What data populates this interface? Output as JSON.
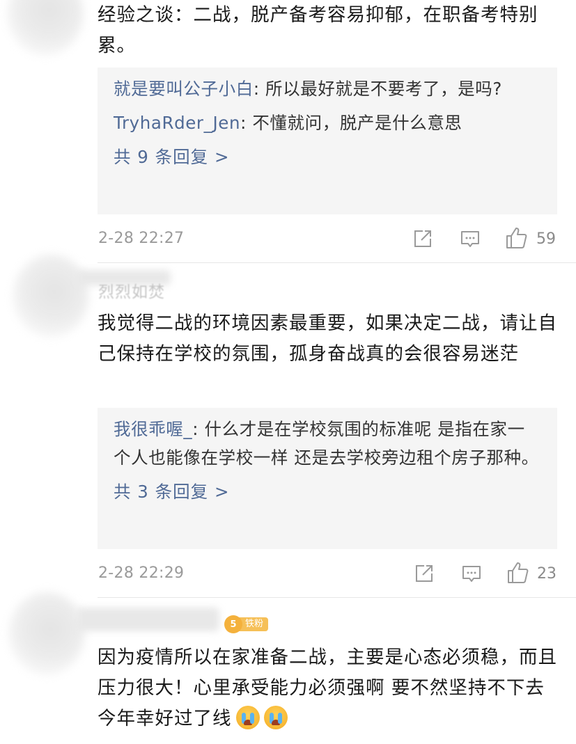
{
  "comments": [
    {
      "text": "经验之谈：二战，脱产备考容易抑郁，在职备考特别累。",
      "replies": [
        {
          "name": "就是要叫公子小白",
          "text": ": 所以最好就是不要考了，是吗?"
        },
        {
          "name": "TryhaRder_Jen",
          "text": ": 不懂就问，脱产是什么意思"
        }
      ],
      "more": "共 9 条回复 >",
      "time": "2-28 22:27",
      "likes": "59"
    },
    {
      "username": "烈烈如焚",
      "text": "我觉得二战的环境因素最重要，如果决定二战，请让自己保持在学校的氛围，孤身奋战真的会很容易迷茫",
      "replies": [
        {
          "name": "我很乖喔_",
          "text": ": 什么才是在学校氛围的标准呢 是指在家一个人也能像在学校一样 还是去学校旁边租个房子那种。"
        }
      ],
      "more": "共 3 条回复 >",
      "time": "2-28 22:29",
      "likes": "23"
    },
    {
      "badge_level": "5",
      "badge_label": "铁粉",
      "text": "因为疫情所以在家准备二战，主要是心态必须稳，而且压力很大！心里承受能力必须强啊 要不然坚持不下去 今年幸好过了线",
      "emoji": "crying-face-icon"
    }
  ],
  "colors": {
    "link": "#506a96",
    "reply_bg": "#f5f5f5",
    "meta": "#9a9a9a",
    "badge": "#f6c058"
  }
}
